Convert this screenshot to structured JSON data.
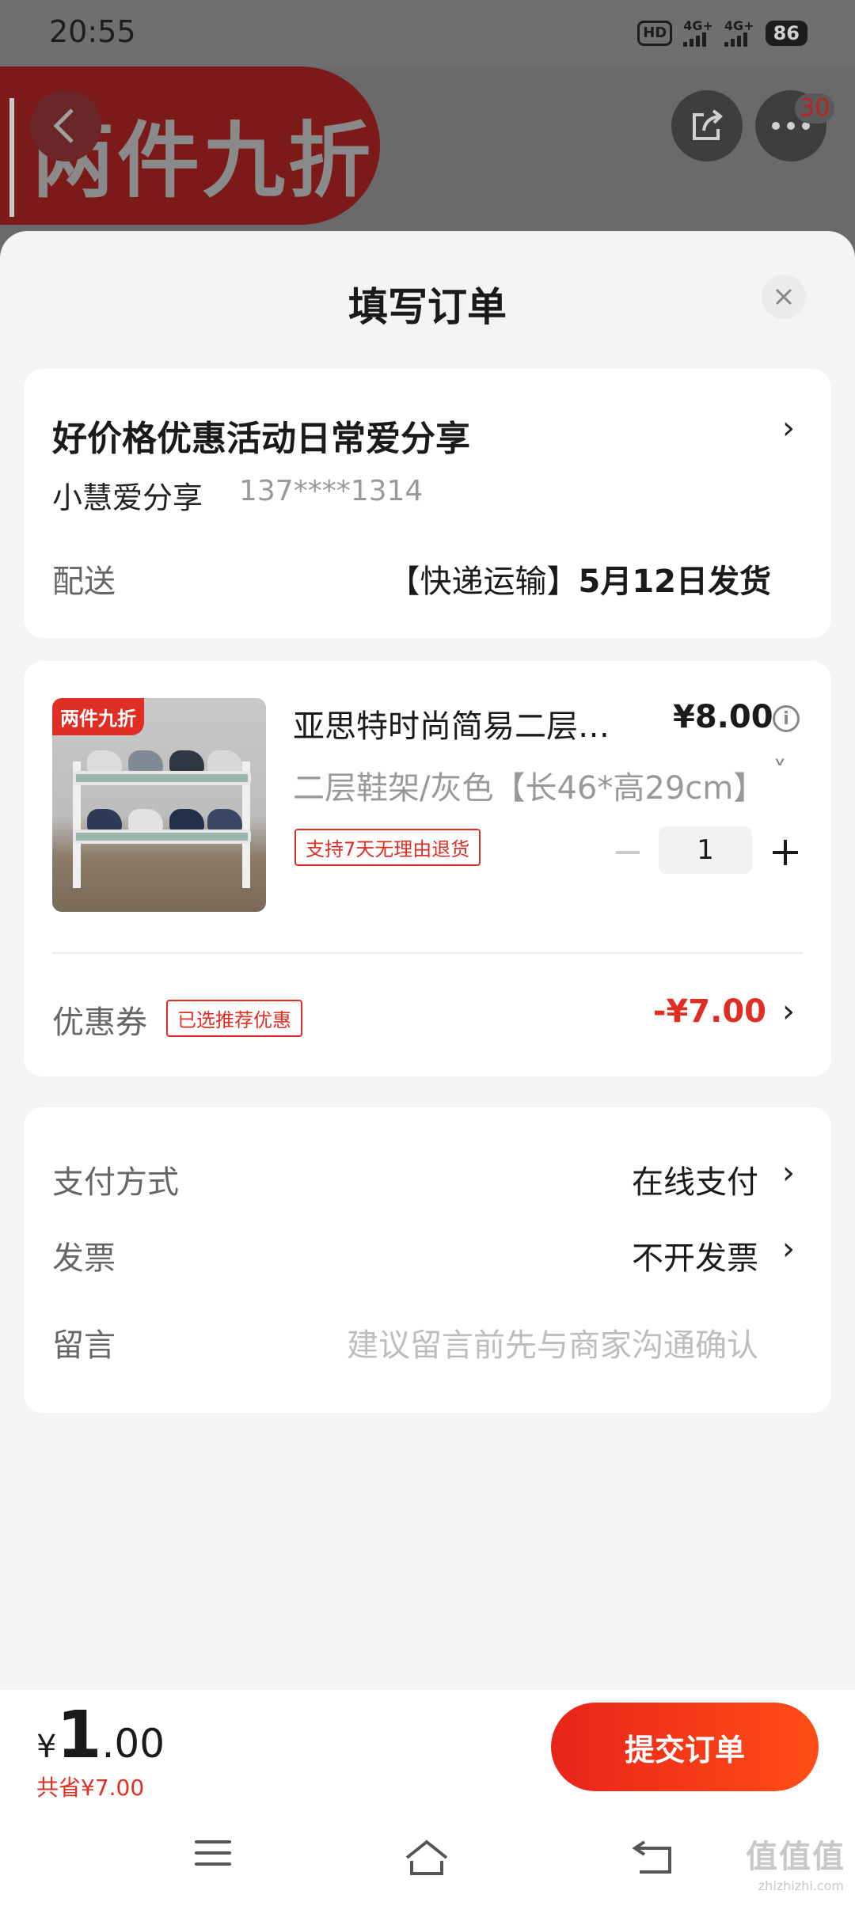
{
  "status_bar": {
    "time": "20:55",
    "hd_label": "HD",
    "network_1": "4G+",
    "network_2": "4G+",
    "battery": "86"
  },
  "background_header": {
    "promo_text": "两件九折",
    "more_badge_count": "30"
  },
  "sheet": {
    "title": "填写订单"
  },
  "address": {
    "name": "好价格优惠活动日常爱分享",
    "contact_name": "小慧爱分享",
    "phone": "137****1314",
    "shipping_label": "配送",
    "shipping_method": "【快递运输】",
    "shipping_date": "5月12日发货"
  },
  "product": {
    "thumb_tag": "两件九折",
    "title": "亚思特时尚简易二层鞋架",
    "price": "¥8.00",
    "spec": "二层鞋架/灰色【长46*高29cm】",
    "return_policy": "支持7天无理由退货",
    "quantity": "1"
  },
  "coupon": {
    "label": "优惠券",
    "tag": "已选推荐优惠",
    "value": "-¥7.00"
  },
  "payment": {
    "method_label": "支付方式",
    "method_value": "在线支付",
    "invoice_label": "发票",
    "invoice_value": "不开发票",
    "remark_label": "留言",
    "remark_placeholder": "建议留言前先与商家沟通确认"
  },
  "bottom_bar": {
    "currency": "¥",
    "total_integer": "1",
    "total_decimal": ".00",
    "saved": "共省¥7.00",
    "submit_label": "提交订单"
  },
  "watermark": {
    "text": "值值值",
    "sub": "zhizhizhi.com"
  },
  "colors": {
    "accent": "#e02e24",
    "submit_gradient_end": "#ff4e16"
  }
}
